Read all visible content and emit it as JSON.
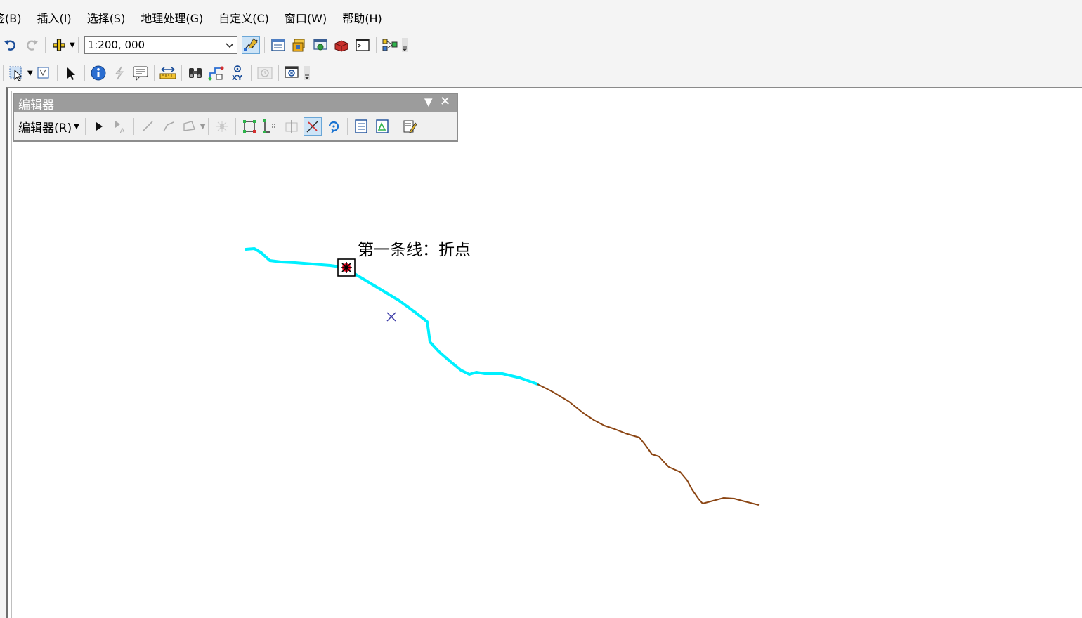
{
  "menu": {
    "items": [
      {
        "label": "签(B)"
      },
      {
        "label": "插入(I)"
      },
      {
        "label": "选择(S)"
      },
      {
        "label": "地理处理(G)"
      },
      {
        "label": "自定义(C)"
      },
      {
        "label": "窗口(W)"
      },
      {
        "label": "帮助(H)"
      }
    ]
  },
  "standard_toolbar": {
    "scale_value": "1:200, 000",
    "icons": [
      "undo-icon",
      "redo-icon",
      "add-data-icon",
      "scale-dropdown",
      "editor-toolbar-icon",
      "table-of-contents-icon",
      "catalog-icon",
      "search-window-icon",
      "arctoolbox-icon",
      "python-window-icon",
      "model-builder-icon"
    ]
  },
  "tools_toolbar": {
    "icons": [
      "select-features-icon",
      "clear-selection-icon",
      "select-elements-icon",
      "identify-icon",
      "hyperlink-icon",
      "html-popup-icon",
      "measure-icon",
      "find-icon",
      "find-route-icon",
      "go-to-xy-icon",
      "time-slider-icon",
      "magnifier-icon"
    ]
  },
  "editor": {
    "title": "编辑器",
    "menu_label": "编辑器(R)"
  },
  "map": {
    "annotation": "第一条线：折点",
    "colors": {
      "selected_line": "#00f0ff",
      "other_line": "#8b4513",
      "vertex_marker": "#e0001b",
      "centroid_cross": "#3d3da8"
    }
  }
}
